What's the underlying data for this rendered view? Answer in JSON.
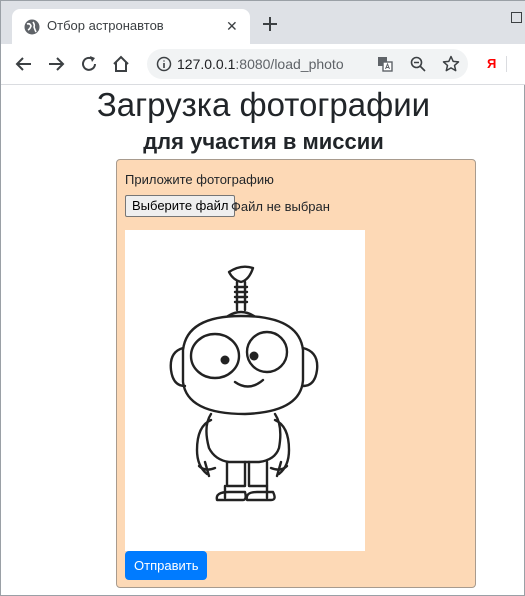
{
  "browser": {
    "tab": {
      "title": "Отбор астронавтов",
      "close": "✕"
    },
    "new_tab": "+",
    "address": {
      "host": "127.0.0.1",
      "port_path": ":8080/load_photo"
    },
    "yandex": "Я"
  },
  "page": {
    "title": "Загрузка фотографии",
    "subtitle": "для участия в миссии"
  },
  "form": {
    "attach_label": "Приложите фотографию",
    "file_button": "Выберите файл",
    "file_status": "Файл не выбран",
    "submit_label": "Отправить",
    "card_color": "#fdd9b6",
    "accent": "#007bff"
  }
}
